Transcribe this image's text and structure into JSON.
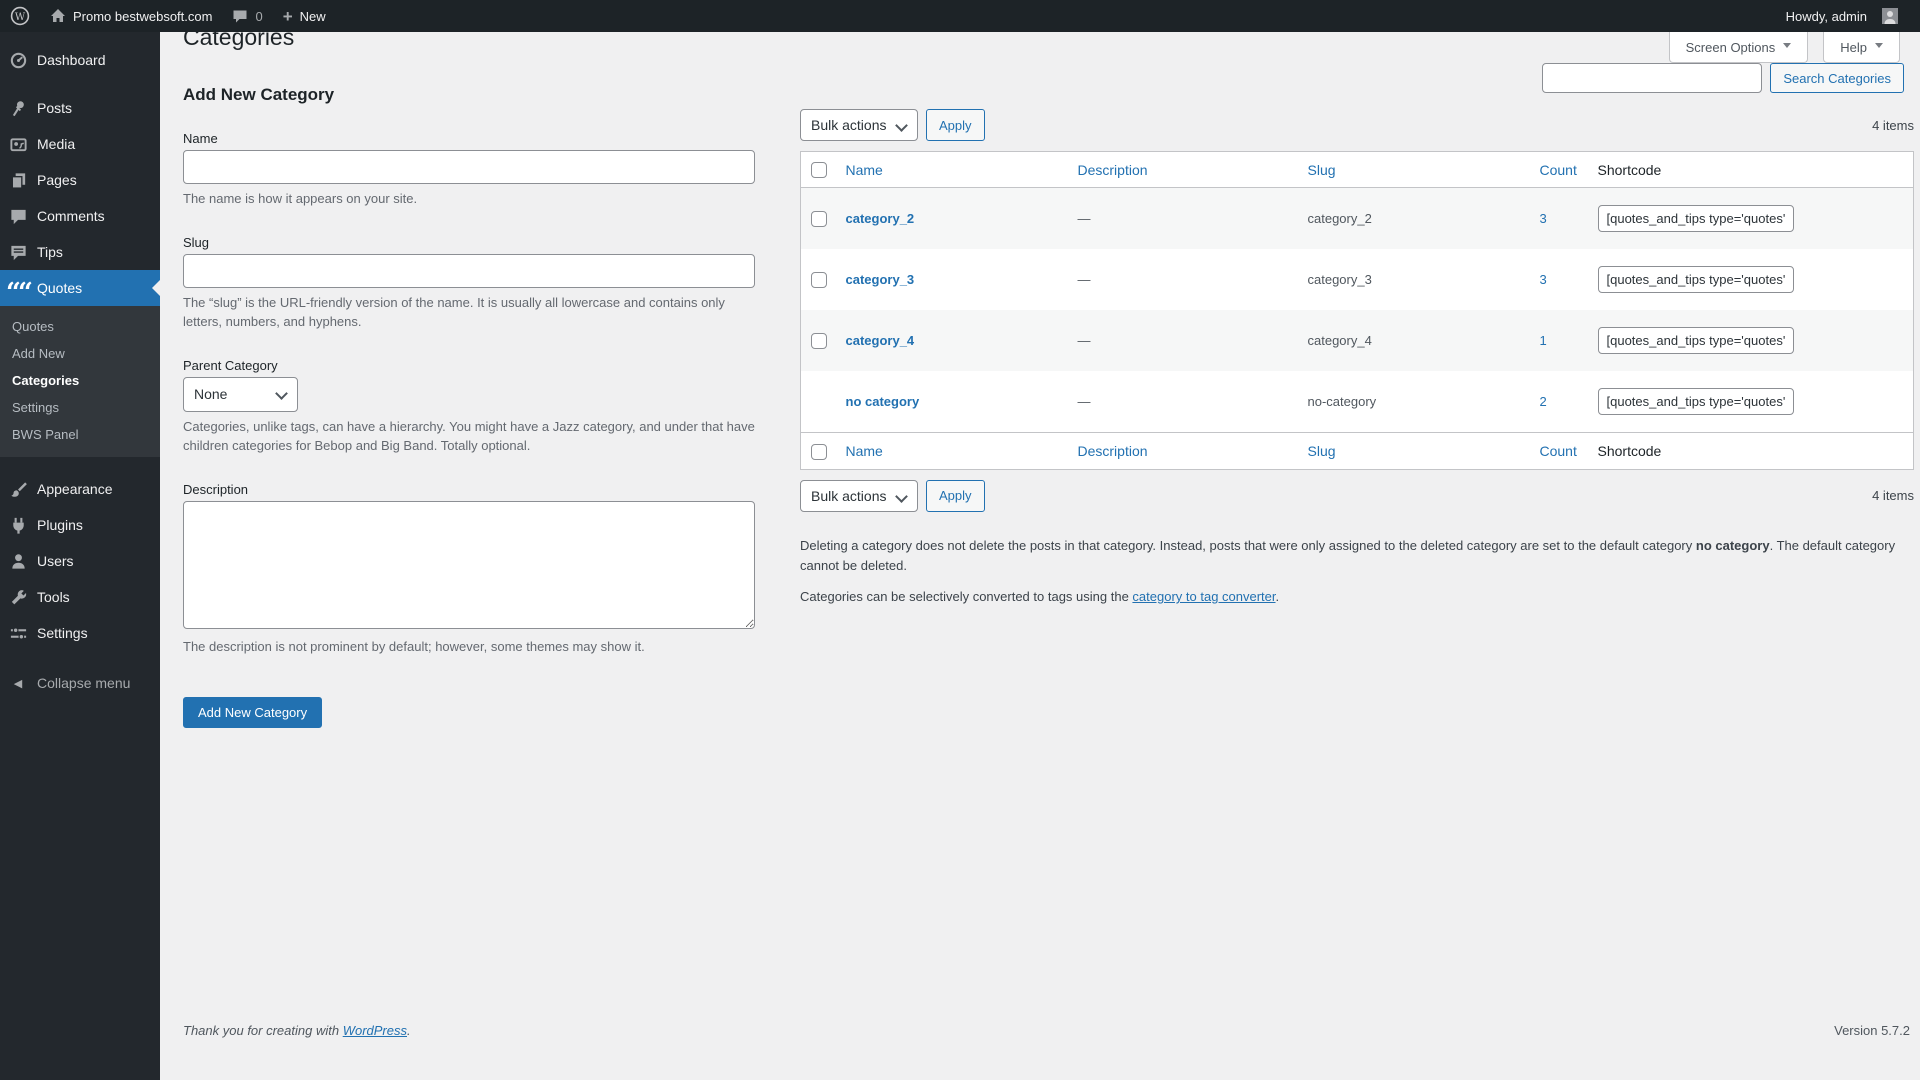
{
  "admin_bar": {
    "site_name": "Promo bestwebsoft.com",
    "comments_count": "0",
    "new_label": "New",
    "howdy_text": "Howdy, admin"
  },
  "screen_meta": {
    "screen_options_label": "Screen Options",
    "help_label": "Help"
  },
  "page": {
    "title": "Categories"
  },
  "sidebar": {
    "items": [
      {
        "label": "Dashboard"
      },
      {
        "label": "Posts"
      },
      {
        "label": "Media"
      },
      {
        "label": "Pages"
      },
      {
        "label": "Comments"
      },
      {
        "label": "Tips"
      },
      {
        "label": "Quotes"
      },
      {
        "label": "Appearance"
      },
      {
        "label": "Plugins"
      },
      {
        "label": "Users"
      },
      {
        "label": "Tools"
      },
      {
        "label": "Settings"
      }
    ],
    "quotes_submenu": [
      {
        "label": "Quotes"
      },
      {
        "label": "Add New"
      },
      {
        "label": "Categories"
      },
      {
        "label": "Settings"
      },
      {
        "label": "BWS Panel"
      }
    ],
    "collapse_label": "Collapse menu"
  },
  "form": {
    "heading": "Add New Category",
    "name_label": "Name",
    "name_help": "The name is how it appears on your site.",
    "slug_label": "Slug",
    "slug_help": "The “slug” is the URL-friendly version of the name. It is usually all lowercase and contains only letters, numbers, and hyphens.",
    "parent_label": "Parent Category",
    "parent_value": "None",
    "parent_help": "Categories, unlike tags, can have a hierarchy. You might have a Jazz category, and under that have children categories for Bebop and Big Band. Totally optional.",
    "description_label": "Description",
    "description_help": "The description is not prominent by default; however, some themes may show it.",
    "submit_label": "Add New Category"
  },
  "search": {
    "button_label": "Search Categories"
  },
  "tablenav": {
    "bulk_actions_label": "Bulk actions",
    "apply_label": "Apply",
    "items_count": "4 items"
  },
  "table": {
    "columns": {
      "name": "Name",
      "description": "Description",
      "slug": "Slug",
      "count": "Count",
      "shortcode": "Shortcode"
    },
    "rows": [
      {
        "name": "category_2",
        "description": "—",
        "slug": "category_2",
        "count": "3",
        "shortcode": "[quotes_and_tips type='quotes'"
      },
      {
        "name": "category_3",
        "description": "—",
        "slug": "category_3",
        "count": "3",
        "shortcode": "[quotes_and_tips type='quotes'"
      },
      {
        "name": "category_4",
        "description": "—",
        "slug": "category_4",
        "count": "1",
        "shortcode": "[quotes_and_tips type='quotes'"
      },
      {
        "name": "no category",
        "description": "—",
        "slug": "no-category",
        "count": "2",
        "shortcode": "[quotes_and_tips type='quotes'"
      }
    ]
  },
  "notes": {
    "note1_before": "Deleting a category does not delete the posts in that category. Instead, posts that were only assigned to the deleted category are set to the default category ",
    "note1_bold": "no category",
    "note1_after": ". The default category cannot be deleted.",
    "note2_before": "Categories can be selectively converted to tags using the ",
    "note2_link": "category to tag converter",
    "note2_after": "."
  },
  "footer": {
    "thanks_before": "Thank you for creating with ",
    "thanks_link": "WordPress",
    "thanks_after": ".",
    "version": "Version 5.7.2"
  },
  "colors": {
    "accent_blue": "#2271b1",
    "admin_bar_bg": "#1d2327",
    "menu_bg": "#23282d",
    "submenu_bg": "#32373c",
    "content_bg": "#f0f0f1",
    "row_alt_bg": "#f6f7f7"
  }
}
